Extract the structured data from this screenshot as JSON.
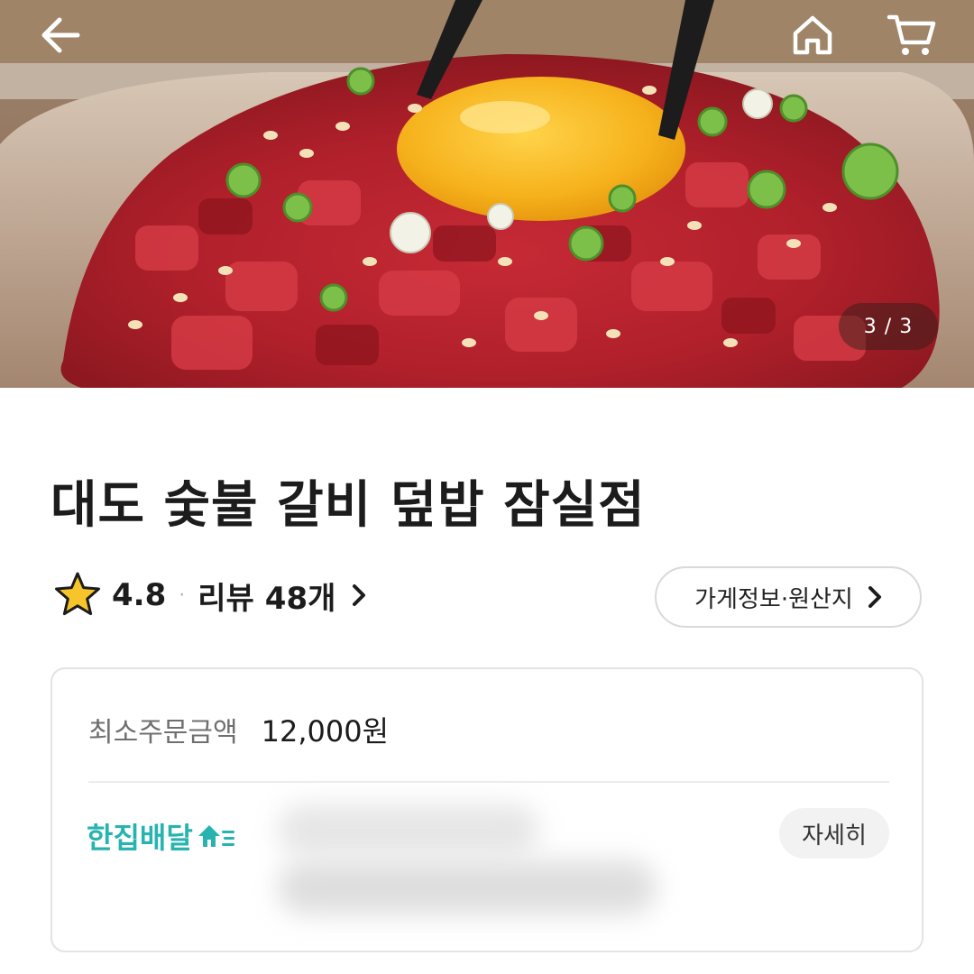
{
  "hero": {
    "page_indicator": "3 / 3"
  },
  "nav": {
    "back_icon": "arrow-left-icon",
    "home_icon": "home-icon",
    "cart_icon": "cart-icon"
  },
  "store": {
    "name": "대도 숯불 갈비 덮밥 잠실점",
    "rating": "4.8",
    "separator": "·",
    "review_prefix": "리뷰",
    "review_count": "48개",
    "info_button_label": "가게정보·원산지"
  },
  "delivery_card": {
    "min_order_label": "최소주문금액",
    "min_order_value": "12,000원",
    "brand_label": "한집배달",
    "detail_button_label": "자세히"
  },
  "colors": {
    "brand_teal": "#27b3b0",
    "star_yellow": "#f7c52b",
    "text_primary": "#1c1c1c",
    "text_secondary": "#6f6f6f"
  }
}
